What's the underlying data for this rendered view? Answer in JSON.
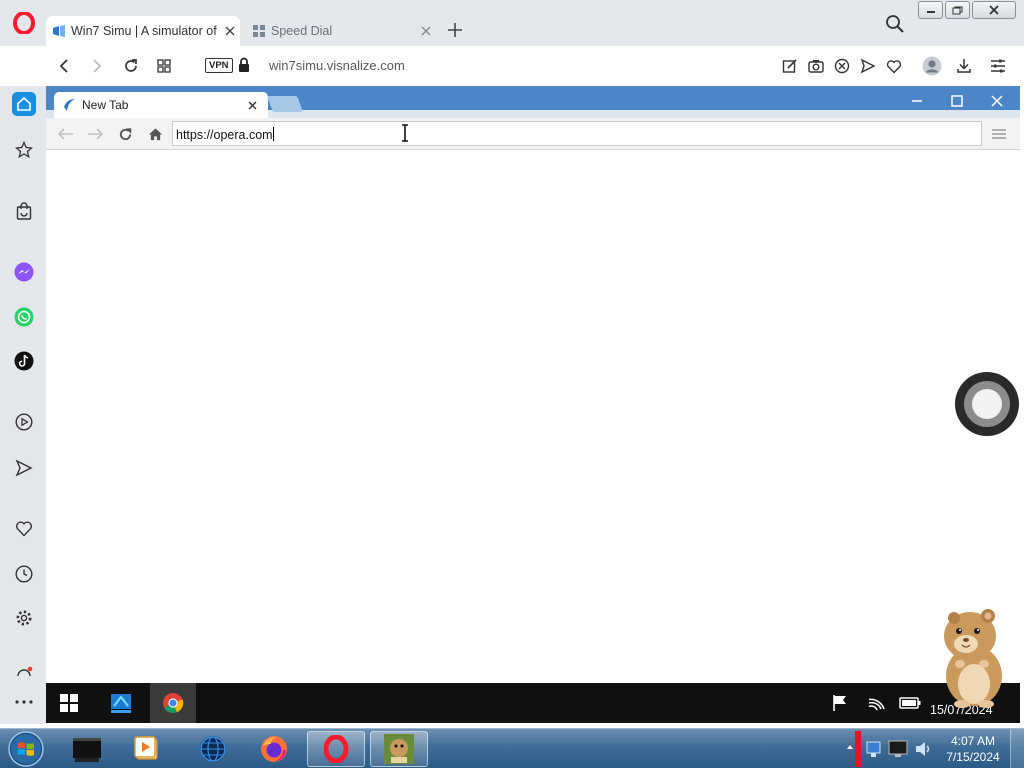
{
  "opera": {
    "tabs": [
      {
        "title": "Win7 Simu | A simulator of",
        "icon": "win7simu-favicon-icon",
        "active": true
      },
      {
        "title": "Speed Dial",
        "icon": "speed-dial-icon",
        "active": false
      }
    ],
    "address": {
      "vpn_label": "VPN",
      "url": "win7simu.visnalize.com"
    },
    "sidebar": [
      "home-icon",
      "bookmarks-icon",
      "shopping-icon",
      "messenger-icon",
      "whatsapp-icon",
      "tiktok-icon",
      "player-icon",
      "send-icon",
      "heart-icon",
      "history-icon",
      "settings-icon",
      "more-icon"
    ],
    "colors": {
      "brand": "#ff1b2d",
      "accent": "#1a8fe3"
    }
  },
  "sim_browser": {
    "tab_title": "New Tab",
    "omnibox_value": "https://opera.com",
    "titlebar_color": "#4a86c8"
  },
  "sim_taskbar": {
    "date": "15/07/2024",
    "apps": [
      "windows-start-icon",
      "edge-icon",
      "chrome-icon"
    ],
    "tray": [
      "flag-icon",
      "wifi-icon",
      "battery-icon"
    ]
  },
  "host_taskbar": {
    "time": "4:07 AM",
    "date": "7/15/2024",
    "apps": [
      "windows-orb-icon",
      "terminal-icon",
      "media-player-icon",
      "globe-icon",
      "firefox-icon",
      "opera-icon",
      "box-app-icon"
    ],
    "active_app": "opera-icon"
  }
}
